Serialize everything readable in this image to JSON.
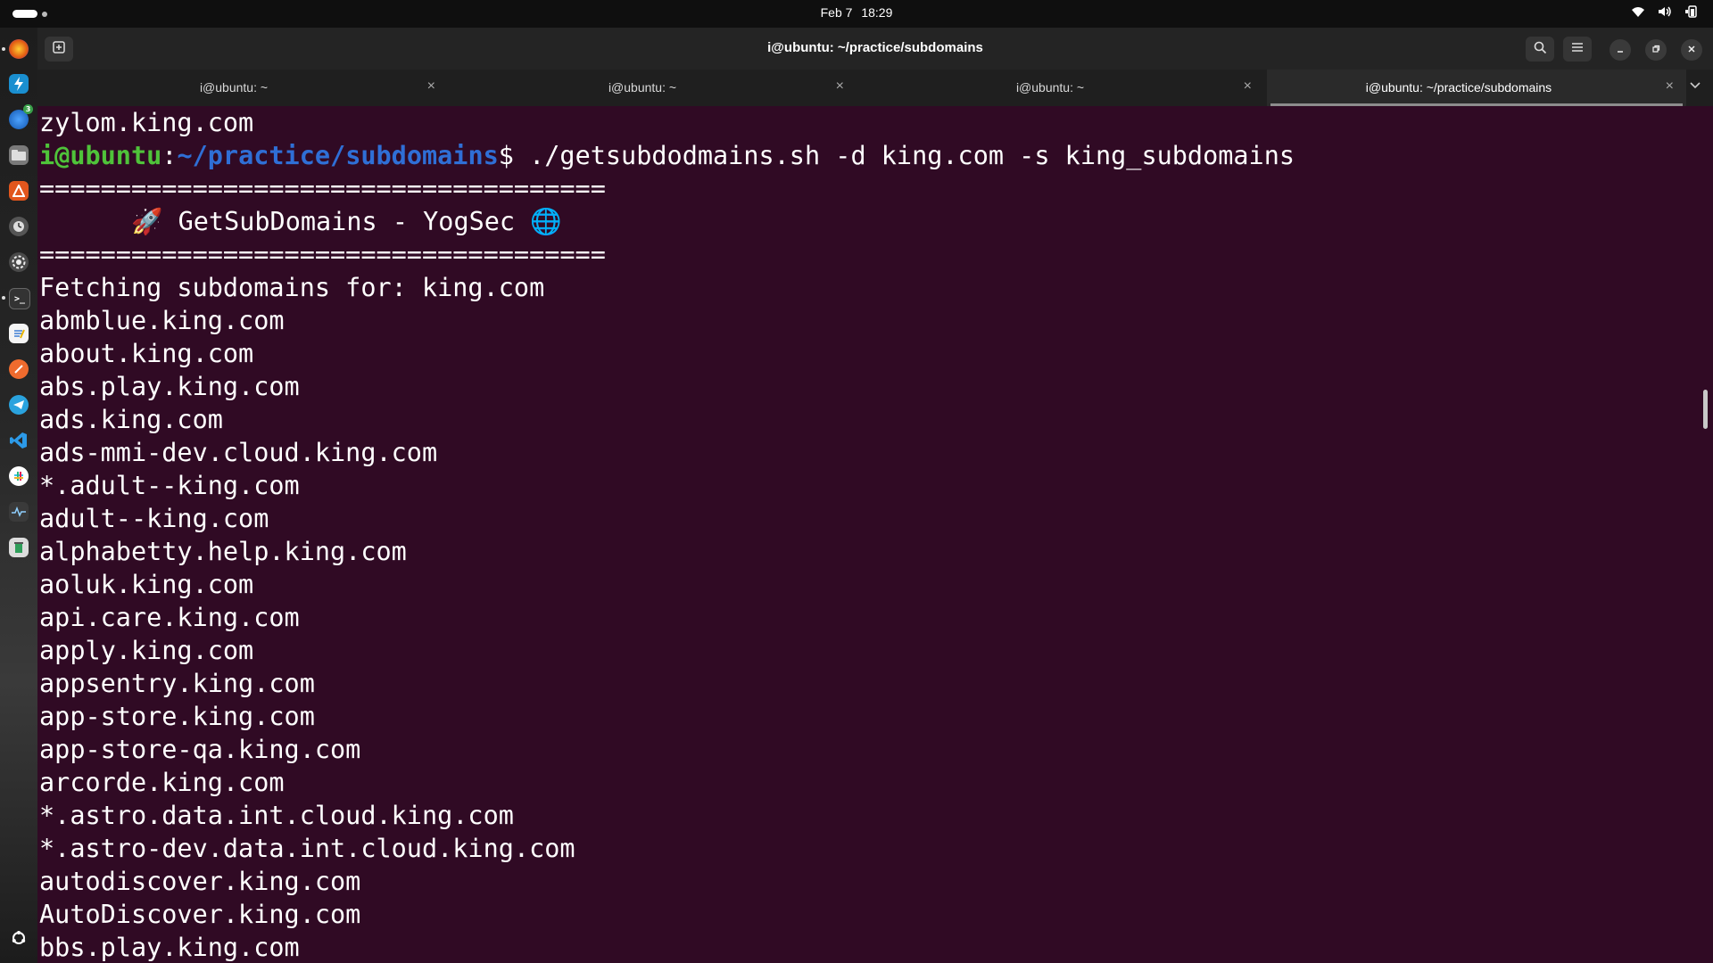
{
  "topbar": {
    "date": "Feb 7",
    "time": "18:29"
  },
  "window": {
    "title": "i@ubuntu: ~/practice/subdomains"
  },
  "tabs": [
    {
      "label": "i@ubuntu: ~",
      "active": false
    },
    {
      "label": "i@ubuntu: ~",
      "active": false
    },
    {
      "label": "i@ubuntu: ~",
      "active": false
    },
    {
      "label": "i@ubuntu: ~/practice/subdomains",
      "active": true
    }
  ],
  "dock": {
    "badge_count": "3"
  },
  "terminal": {
    "prev_output": "zylom.king.com",
    "prompt_user": "i@ubuntu",
    "prompt_sep": ":",
    "prompt_path": "~/practice/subdomains",
    "prompt_symbol": "$",
    "command": " ./getsubdodmains.sh -d king.com -s king_subdomains",
    "banner_rule": "=====================================",
    "banner_title": "      🚀 GetSubDomains - YogSec 🌐",
    "fetching": "Fetching subdomains for: king.com",
    "subdomains": [
      "abmblue.king.com",
      "about.king.com",
      "abs.play.king.com",
      "ads.king.com",
      "ads-mmi-dev.cloud.king.com",
      "*.adult--king.com",
      "adult--king.com",
      "alphabetty.help.king.com",
      "aoluk.king.com",
      "api.care.king.com",
      "apply.king.com",
      "appsentry.king.com",
      "app-store.king.com",
      "app-store-qa.king.com",
      "arcorde.king.com",
      "*.astro.data.int.cloud.king.com",
      "*.astro-dev.data.int.cloud.king.com",
      "autodiscover.king.com",
      "AutoDiscover.king.com",
      "bbs.play.king.com"
    ]
  }
}
